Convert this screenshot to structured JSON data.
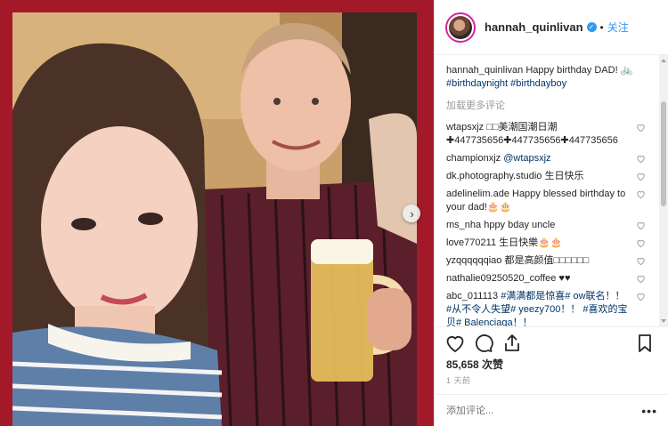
{
  "post": {
    "username": "hannah_quinlivan",
    "follow_label": "关注",
    "separator": "•",
    "caption_text": "Happy birthday DAD! 🚲",
    "caption_tags": "#birthdaynight #birthdayboy",
    "load_more": "加载更多评论",
    "likes": "85,658 次赞",
    "time": "1 天前",
    "add_comment_placeholder": "添加评论...",
    "more_options": "•••",
    "next_arrow": "›",
    "verified_mark": "✓"
  },
  "comments": [
    {
      "user": "wtapsxjz",
      "text": "□□美潮国潮日潮 ✚447735656✚447735656✚447735656"
    },
    {
      "user": "championxjz",
      "text": "",
      "mention": "@wtapsxjz"
    },
    {
      "user": "dk.photography.studio",
      "text": "生日快乐"
    },
    {
      "user": "adelinelim.ade",
      "text": "Happy blessed birthday to your dad!🎂🎂"
    },
    {
      "user": "ms_nha",
      "text": "hppy bday uncle"
    },
    {
      "user": "love770211",
      "text": "生日快樂🎂🎂"
    },
    {
      "user": "yzqqqqqqiao",
      "text": "都是高颜值□□□□□□"
    },
    {
      "user": "nathalie09250520_coffee",
      "text": "♥♥"
    },
    {
      "user": "abc_011113",
      "text": "",
      "mention": "#满满都是惊喜# ow联名！！ #从不令人失望# yeezy700！！ #喜欢的宝贝# Balenciaga！！"
    }
  ],
  "colors": {
    "frame": "#a3192a",
    "link": "#003569",
    "follow": "#3897f0",
    "muted": "#999999"
  },
  "icons": [
    "heart-icon",
    "comment-icon",
    "share-icon",
    "bookmark-icon",
    "verified-icon",
    "chevron-right-icon"
  ]
}
